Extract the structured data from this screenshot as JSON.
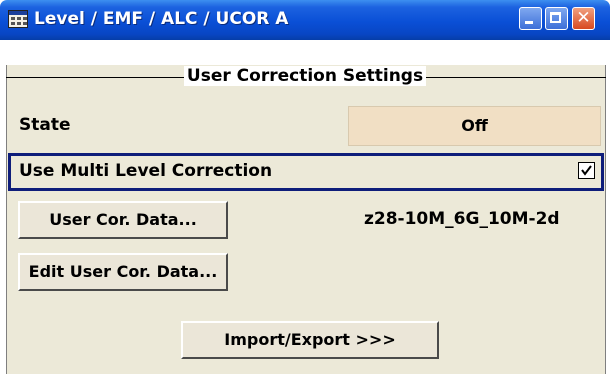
{
  "window": {
    "title": "Level / EMF / ALC / UCOR  A",
    "colors": {
      "titlebar": "#0a4fd6",
      "panel": "#ece9d8",
      "state_button": "#f1dfc4",
      "focus_border": "#0e1d7a"
    }
  },
  "group": {
    "title": "User Correction Settings"
  },
  "state": {
    "label": "State",
    "value": "Off"
  },
  "multi_level": {
    "label": "Use Multi Level Correction",
    "checked": true
  },
  "user_cor_data": {
    "button_label": "User Cor. Data...",
    "file_name": "z28-10M_6G_10M-2d"
  },
  "edit": {
    "button_label": "Edit User Cor. Data..."
  },
  "import_export": {
    "button_label": "Import/Export >>>"
  }
}
